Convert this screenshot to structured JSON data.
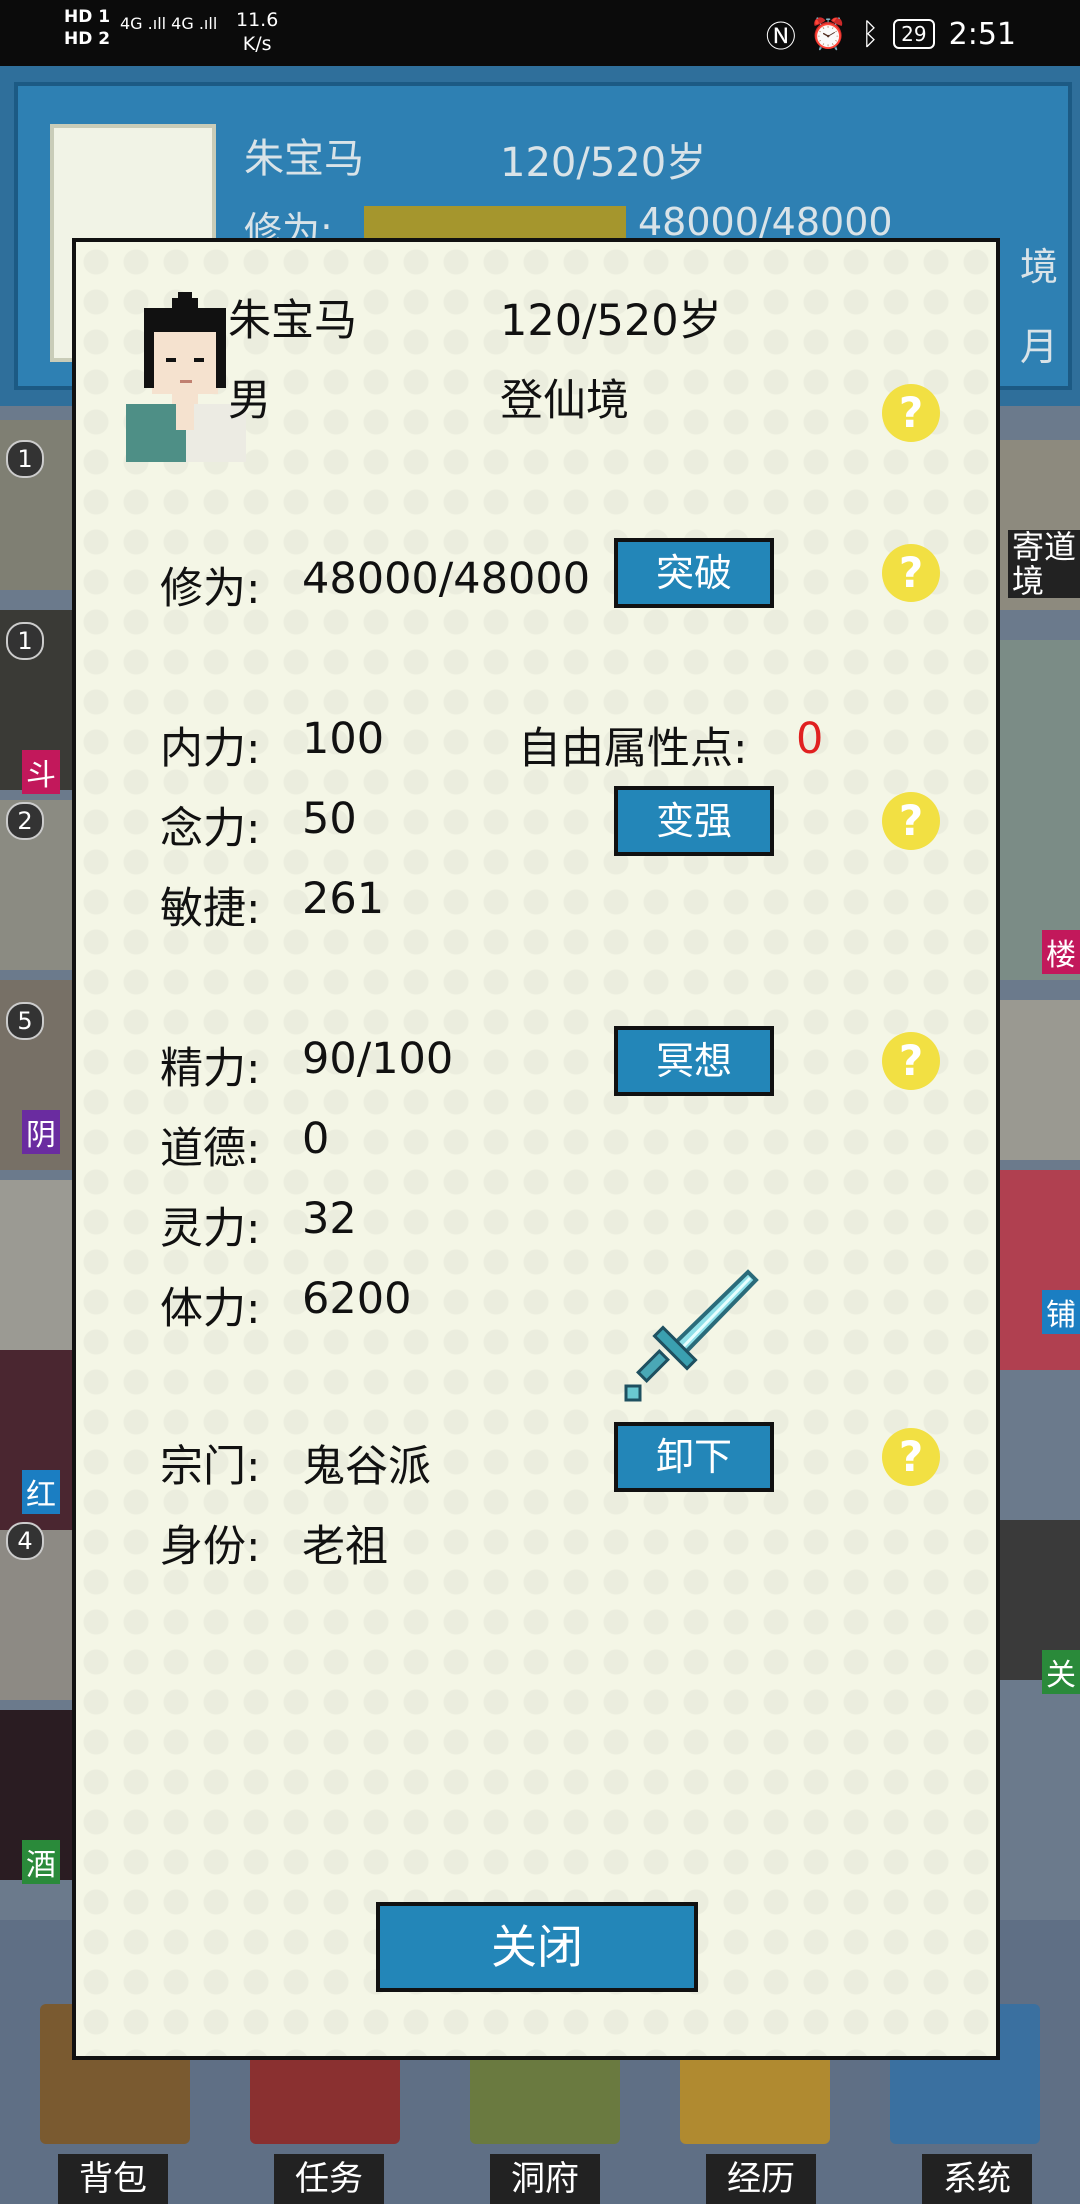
{
  "status_bar": {
    "network_labels": "HD 1\nHD 2",
    "signal": "4G .ıll 4G .ıll",
    "speed": "11.6\nK/s",
    "icons": [
      "nfc-icon",
      "alarm-icon",
      "bluetooth-icon"
    ],
    "battery": "29",
    "time": "2:51"
  },
  "background_header": {
    "name": "朱宝马",
    "age": "120/520岁",
    "cultivation_label": "修为:",
    "cultivation_value": "48000/48000",
    "cultivation_progress": 1.0,
    "right_clip_1": "境",
    "right_clip_2": "月"
  },
  "background_tiles": {
    "left_badges": [
      "1",
      "1",
      "2",
      "5",
      "4"
    ],
    "left_tags": [
      "斗",
      "阴",
      "红",
      "酒"
    ],
    "right_tags": [
      "寄道\n境",
      "楼",
      "铺",
      "关"
    ]
  },
  "bottom_nav": {
    "items": [
      "背包",
      "任务",
      "洞府",
      "经历",
      "系统"
    ]
  },
  "dialog": {
    "name": "朱宝马",
    "age": "120/520岁",
    "gender": "男",
    "realm": "登仙境",
    "cultivation": {
      "label": "修为:",
      "value": "48000/48000"
    },
    "breakthrough_button": "突破",
    "stats_group1": [
      {
        "label": "内力:",
        "value": "100"
      },
      {
        "label": "念力:",
        "value": "50"
      },
      {
        "label": "敏捷:",
        "value": "261"
      }
    ],
    "free_points": {
      "label": "自由属性点:",
      "value": "0"
    },
    "strengthen_button": "变强",
    "stats_group2": [
      {
        "label": "精力:",
        "value": "90/100"
      },
      {
        "label": "道德:",
        "value": "0"
      },
      {
        "label": "灵力:",
        "value": "32"
      },
      {
        "label": "体力:",
        "value": "6200"
      }
    ],
    "meditate_button": "冥想",
    "sect": {
      "label": "宗门:",
      "value": "鬼谷派"
    },
    "identity": {
      "label": "身份:",
      "value": "老祖"
    },
    "unequip_button": "卸下",
    "help_symbol": "?",
    "close_button": "关闭",
    "colors": {
      "button": "#2386b8",
      "help": "#f2e043",
      "free_points_value": "#e02020",
      "panel": "#f4f6e6"
    }
  }
}
